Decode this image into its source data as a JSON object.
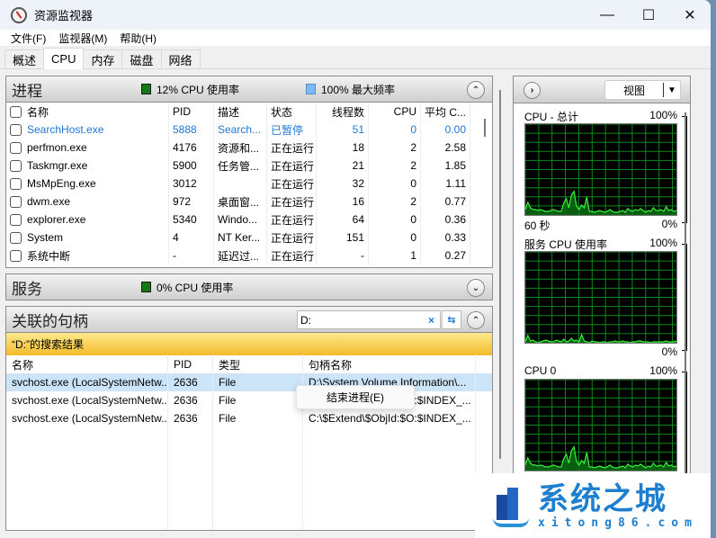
{
  "window": {
    "title": "资源监视器",
    "minimize": "—",
    "maximize": "☐",
    "close": "✕"
  },
  "menu": [
    "文件(F)",
    "监视器(M)",
    "帮助(H)"
  ],
  "tabs": [
    {
      "label": "概述",
      "active": false
    },
    {
      "label": "CPU",
      "active": true
    },
    {
      "label": "内存",
      "active": false
    },
    {
      "label": "磁盘",
      "active": false
    },
    {
      "label": "网络",
      "active": false
    }
  ],
  "processes": {
    "title": "进程",
    "cpu_usage": "12% CPU 使用率",
    "max_freq": "100% 最大频率",
    "columns": [
      "名称",
      "PID",
      "描述",
      "状态",
      "线程数",
      "CPU",
      "平均 C..."
    ],
    "rows": [
      {
        "name": "SearchHost.exe",
        "pid": "5888",
        "desc": "Search...",
        "status": "已暂停",
        "threads": "51",
        "cpu": "0",
        "avg": "0.00",
        "highlight": true
      },
      {
        "name": "perfmon.exe",
        "pid": "4176",
        "desc": "资源和...",
        "status": "正在运行",
        "threads": "18",
        "cpu": "2",
        "avg": "2.58",
        "highlight": false
      },
      {
        "name": "Taskmgr.exe",
        "pid": "5900",
        "desc": "任务管...",
        "status": "正在运行",
        "threads": "21",
        "cpu": "2",
        "avg": "1.85",
        "highlight": false
      },
      {
        "name": "MsMpEng.exe",
        "pid": "3012",
        "desc": "",
        "status": "正在运行",
        "threads": "32",
        "cpu": "0",
        "avg": "1.11",
        "highlight": false
      },
      {
        "name": "dwm.exe",
        "pid": "972",
        "desc": "桌面窗...",
        "status": "正在运行",
        "threads": "16",
        "cpu": "2",
        "avg": "0.77",
        "highlight": false
      },
      {
        "name": "explorer.exe",
        "pid": "5340",
        "desc": "Windo...",
        "status": "正在运行",
        "threads": "64",
        "cpu": "0",
        "avg": "0.36",
        "highlight": false
      },
      {
        "name": "System",
        "pid": "4",
        "desc": "NT Ker...",
        "status": "正在运行",
        "threads": "151",
        "cpu": "0",
        "avg": "0.33",
        "highlight": false
      },
      {
        "name": "系统中断",
        "pid": "-",
        "desc": "延迟过...",
        "status": "正在运行",
        "threads": "-",
        "cpu": "1",
        "avg": "0.27",
        "highlight": false
      }
    ]
  },
  "services": {
    "title": "服务",
    "cpu_usage": "0% CPU 使用率"
  },
  "handles": {
    "title": "关联的句柄",
    "search_value": "D:",
    "clear_icon": "×",
    "search_results": "“D:”的搜索结果",
    "columns": [
      "名称",
      "PID",
      "类型",
      "句柄名称"
    ],
    "rows": [
      {
        "name": "svchost.exe (LocalSystemNetw...",
        "pid": "2636",
        "type": "File",
        "handle": "D:\\System Volume Information\\...",
        "selected": true
      },
      {
        "name": "svchost.exe (LocalSystemNetw...",
        "pid": "2636",
        "type": "File",
        "handle": "D:\\$Extend\\$ObjId:$O:$INDEX_...",
        "selected": false
      },
      {
        "name": "svchost.exe (LocalSystemNetw...",
        "pid": "2636",
        "type": "File",
        "handle": "C:\\$Extend\\$ObjId:$O:$INDEX_...",
        "selected": false
      }
    ]
  },
  "context_menu": {
    "items": [
      "结束进程(E)"
    ]
  },
  "graphs": {
    "view_label": "视图",
    "items": [
      {
        "title": "CPU - 总计",
        "max": "100%",
        "min": "0%",
        "time": "60 秒",
        "values": [
          6,
          14,
          8,
          6,
          6,
          5,
          6,
          5,
          4,
          4,
          5,
          6,
          5,
          4,
          4,
          13,
          18,
          8,
          22,
          26,
          10,
          6,
          11,
          8,
          20,
          4,
          4,
          3,
          4,
          5,
          4,
          3,
          4,
          6,
          4,
          3,
          3,
          4,
          5,
          3,
          7,
          5,
          4,
          6,
          5,
          7,
          5,
          3,
          5,
          4,
          8,
          5,
          5,
          6,
          4,
          9,
          5,
          6,
          4,
          5
        ]
      },
      {
        "title": "服务 CPU 使用率",
        "max": "100%",
        "min": "0%",
        "time": "",
        "values": [
          1,
          8,
          2,
          3,
          1,
          0,
          1,
          2,
          3,
          2,
          1,
          1,
          3,
          2,
          1,
          4,
          1,
          2,
          5,
          2,
          3,
          1,
          9,
          2,
          1,
          0,
          2,
          1,
          1,
          0,
          1,
          1,
          0,
          1,
          1,
          2,
          1,
          1,
          2,
          1,
          1,
          0,
          1,
          1,
          2,
          2,
          1,
          1,
          1,
          0,
          1,
          1,
          1,
          1,
          1,
          2,
          1,
          1,
          1,
          2
        ]
      },
      {
        "title": "CPU 0",
        "max": "100%",
        "min": "",
        "time": "",
        "values": [
          6,
          14,
          8,
          6,
          6,
          5,
          6,
          5,
          4,
          4,
          5,
          6,
          5,
          4,
          4,
          13,
          18,
          8,
          22,
          26,
          10,
          6,
          11,
          8,
          20,
          4,
          4,
          3,
          4,
          5,
          4,
          3,
          4,
          6,
          4,
          3,
          3,
          4,
          5,
          3,
          7,
          5,
          4,
          6,
          5,
          7,
          5,
          3,
          5,
          4,
          8,
          5,
          5,
          6,
          4,
          9,
          5,
          6,
          4,
          5
        ]
      }
    ]
  },
  "watermark": {
    "title": "系统之城",
    "url": "xitong86.com"
  }
}
